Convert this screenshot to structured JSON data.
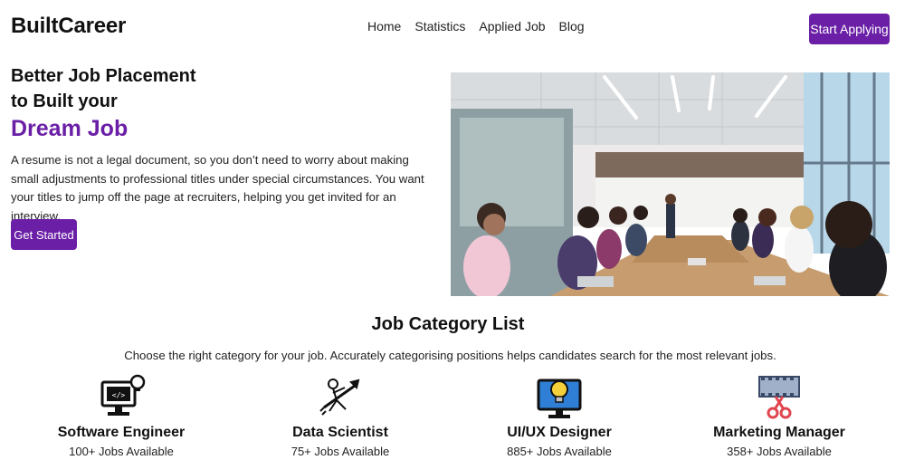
{
  "brand": "BuiltCareer",
  "nav": {
    "items": [
      "Home",
      "Statistics",
      "Applied Job",
      "Blog"
    ],
    "cta_label": "Start Applying"
  },
  "hero": {
    "title_line1": "Better Job Placement",
    "title_line2": "to Built your",
    "title_accent": "Dream Job",
    "description": "A resume is not a legal document, so you don’t need to worry about making small adjustments to professional titles under special circumstances. You want your titles to jump off the page at recruiters, helping you get invited for an interview.",
    "cta_label": "Get Started"
  },
  "categories": {
    "title": "Job Category List",
    "subtitle": "Choose the right category for your job. Accurately categorising positions helps candidates search for the most relevant jobs.",
    "items": [
      {
        "name": "Software Engineer",
        "count": "100+ Jobs Available",
        "icon": "computer-code-icon"
      },
      {
        "name": "Data Scientist",
        "count": "75+ Jobs Available",
        "icon": "rocket-person-icon"
      },
      {
        "name": "UI/UX Designer",
        "count": "885+ Jobs Available",
        "icon": "monitor-lightbulb-icon"
      },
      {
        "name": "Marketing Manager",
        "count": "358+ Jobs Available",
        "icon": "film-scissors-icon"
      }
    ]
  },
  "colors": {
    "accent": "#6a1fa6",
    "text": "#111111"
  }
}
